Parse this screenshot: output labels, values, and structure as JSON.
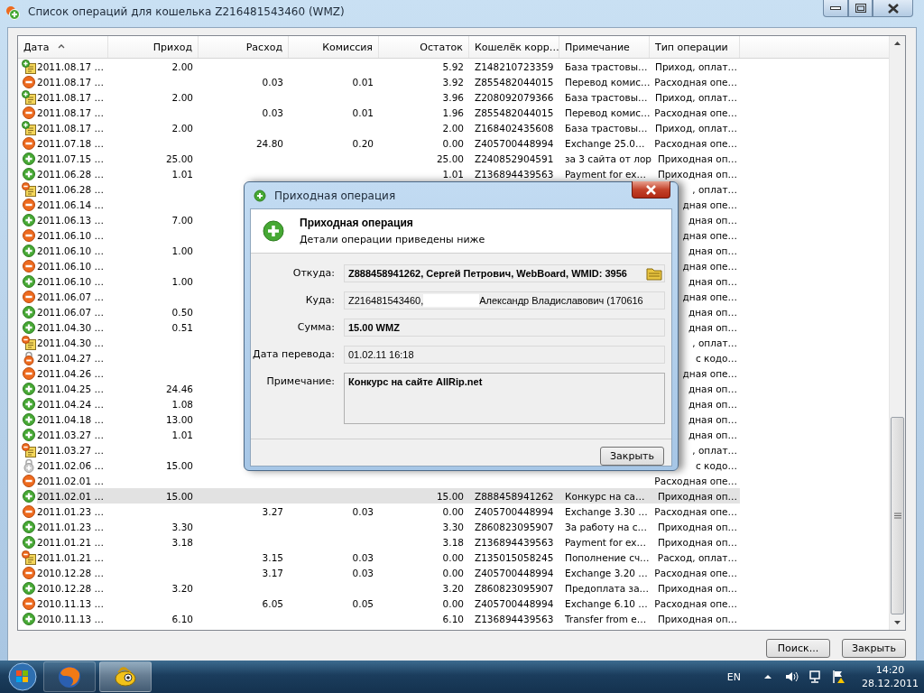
{
  "window": {
    "title": "Список операций для кошелька Z216481543460 (WMZ)"
  },
  "table": {
    "columns": [
      {
        "label": "Дата",
        "sorted": true
      },
      {
        "label": "Приход",
        "sorted": false
      },
      {
        "label": "Расход",
        "sorted": false
      },
      {
        "label": "Комиссия",
        "sorted": false
      },
      {
        "label": "Остаток",
        "sorted": false
      },
      {
        "label": "Кошелёк корр…",
        "sorted": false
      },
      {
        "label": "Примечание",
        "sorted": false
      },
      {
        "label": "Тип операции",
        "sorted": false
      }
    ],
    "rows": [
      {
        "kind": "doc_in",
        "date": "2011.08.17 …",
        "in": "2.00",
        "balance": "5.92",
        "wallet": "Z148210723359",
        "note": "База трастовы…",
        "type": "Приход, оплат…",
        "selected": false
      },
      {
        "kind": "out",
        "date": "2011.08.17 …",
        "out": "0.03",
        "fee": "0.01",
        "balance": "3.92",
        "wallet": "Z855482044015",
        "note": "Перевод комис…",
        "type": "Расходная опе…",
        "selected": false
      },
      {
        "kind": "doc_in",
        "date": "2011.08.17 …",
        "in": "2.00",
        "balance": "3.96",
        "wallet": "Z208092079366",
        "note": "База трастовы…",
        "type": "Приход, оплат…",
        "selected": false
      },
      {
        "kind": "out",
        "date": "2011.08.17 …",
        "out": "0.03",
        "fee": "0.01",
        "balance": "1.96",
        "wallet": "Z855482044015",
        "note": "Перевод комис…",
        "type": "Расходная опе…",
        "selected": false
      },
      {
        "kind": "doc_in",
        "date": "2011.08.17 …",
        "in": "2.00",
        "balance": "2.00",
        "wallet": "Z168402435608",
        "note": "База трастовы…",
        "type": "Приход, оплат…",
        "selected": false
      },
      {
        "kind": "out",
        "date": "2011.07.18 …",
        "out": "24.80",
        "fee": "0.20",
        "balance": "0.00",
        "wallet": "Z405700448994",
        "note": "Exchange 25.0…",
        "type": "Расходная опе…",
        "selected": false
      },
      {
        "kind": "in",
        "date": "2011.07.15 …",
        "in": "25.00",
        "balance": "25.00",
        "wallet": "Z240852904591",
        "note": "за 3 сайта от лор",
        "type": "Приходная оп…",
        "selected": false
      },
      {
        "kind": "in",
        "date": "2011.06.28 …",
        "in": "1.01",
        "balance": "1.01",
        "wallet": "Z136894439563",
        "note": "Payment for ex…",
        "type": "Приходная оп…",
        "selected": false
      },
      {
        "kind": "doc_out",
        "date": "2011.06.28 …",
        "type": ", оплат…",
        "selected": false
      },
      {
        "kind": "out",
        "date": "2011.06.14 …",
        "type": "дная опе…",
        "selected": false
      },
      {
        "kind": "in",
        "date": "2011.06.13 …",
        "in": "7.00",
        "type": "дная оп…",
        "selected": false
      },
      {
        "kind": "out",
        "date": "2011.06.10 …",
        "type": "дная опе…",
        "selected": false
      },
      {
        "kind": "in",
        "date": "2011.06.10 …",
        "in": "1.00",
        "type": "дная оп…",
        "selected": false
      },
      {
        "kind": "out",
        "date": "2011.06.10 …",
        "type": "дная опе…",
        "selected": false
      },
      {
        "kind": "in",
        "date": "2011.06.10 …",
        "in": "1.00",
        "type": "дная оп…",
        "selected": false
      },
      {
        "kind": "out",
        "date": "2011.06.07 …",
        "type": "дная опе…",
        "selected": false
      },
      {
        "kind": "in",
        "date": "2011.06.07 …",
        "in": "0.50",
        "type": "дная оп…",
        "selected": false
      },
      {
        "kind": "in",
        "date": "2011.04.30 …",
        "in": "0.51",
        "type": "дная оп…",
        "selected": false
      },
      {
        "kind": "doc_out",
        "date": "2011.04.30 …",
        "type": ", оплат…",
        "selected": false
      },
      {
        "kind": "lock_out",
        "date": "2011.04.27 …",
        "type": "с кодо…",
        "selected": false
      },
      {
        "kind": "out",
        "date": "2011.04.26 …",
        "type": "дная опе…",
        "selected": false
      },
      {
        "kind": "in",
        "date": "2011.04.25 …",
        "in": "24.46",
        "type": "дная оп…",
        "selected": false
      },
      {
        "kind": "in",
        "date": "2011.04.24 …",
        "in": "1.08",
        "type": "дная оп…",
        "selected": false
      },
      {
        "kind": "in",
        "date": "2011.04.18 …",
        "in": "13.00",
        "type": "дная оп…",
        "selected": false
      },
      {
        "kind": "in",
        "date": "2011.03.27 …",
        "in": "1.01",
        "type": "дная оп…",
        "selected": false
      },
      {
        "kind": "doc_out",
        "date": "2011.03.27 …",
        "type": ", оплат…",
        "selected": false
      },
      {
        "kind": "lock_in",
        "date": "2011.02.06 …",
        "in": "15.00",
        "type": "с кодо…",
        "selected": false
      },
      {
        "kind": "out",
        "date": "2011.02.01 …",
        "type": "Расходная опе…",
        "selected": false
      },
      {
        "kind": "in",
        "date": "2011.02.01 …",
        "in": "15.00",
        "balance": "15.00",
        "wallet": "Z888458941262",
        "note": "Конкурс на са…",
        "type": "Приходная оп…",
        "selected": true
      },
      {
        "kind": "out",
        "date": "2011.01.23 …",
        "out": "3.27",
        "fee": "0.03",
        "balance": "0.00",
        "wallet": "Z405700448994",
        "note": "Exchange 3.30 …",
        "type": "Расходная опе…",
        "selected": false
      },
      {
        "kind": "in",
        "date": "2011.01.23 …",
        "in": "3.30",
        "balance": "3.30",
        "wallet": "Z860823095907",
        "note": "За работу на с…",
        "type": "Приходная оп…",
        "selected": false
      },
      {
        "kind": "in",
        "date": "2011.01.21 …",
        "in": "3.18",
        "balance": "3.18",
        "wallet": "Z136894439563",
        "note": "Payment for ex…",
        "type": "Приходная оп…",
        "selected": false
      },
      {
        "kind": "doc_out",
        "date": "2011.01.21 …",
        "out": "3.15",
        "fee": "0.03",
        "balance": "0.00",
        "wallet": "Z135015058245",
        "note": "Пополнение сч…",
        "type": "Расход, оплат…",
        "selected": false
      },
      {
        "kind": "out",
        "date": "2010.12.28 …",
        "out": "3.17",
        "fee": "0.03",
        "balance": "0.00",
        "wallet": "Z405700448994",
        "note": "Exchange 3.20 …",
        "type": "Расходная опе…",
        "selected": false
      },
      {
        "kind": "in",
        "date": "2010.12.28 …",
        "in": "3.20",
        "balance": "3.20",
        "wallet": "Z860823095907",
        "note": "Предоплата за…",
        "type": "Приходная оп…",
        "selected": false
      },
      {
        "kind": "out",
        "date": "2010.11.13 …",
        "out": "6.05",
        "fee": "0.05",
        "balance": "0.00",
        "wallet": "Z405700448994",
        "note": "Exchange 6.10 …",
        "type": "Расходная опе…",
        "selected": false
      },
      {
        "kind": "in",
        "date": "2010.11.13 …",
        "in": "6.10",
        "balance": "6.10",
        "wallet": "Z136894439563",
        "note": "Transfer from e…",
        "type": "Приходная оп…",
        "selected": false
      }
    ]
  },
  "buttons": [
    "Поиск...",
    "Закрыть"
  ],
  "dialog": {
    "title": "Приходная операция",
    "heading": "Приходная операция",
    "subtitle": "Детали операции приведены ниже",
    "fields": [
      {
        "kind": "wallet",
        "label": "Откуда:",
        "value": "Z888458941262, Сергей Петрович, WebBoard, WMID: 3956",
        "bold": true
      },
      {
        "kind": "masked",
        "label": "Куда:",
        "value": "Z216481543460,",
        "value_after": "Александр Владиславович (170616",
        "bold": false
      },
      {
        "kind": "line",
        "label": "Сумма:",
        "value": "15.00 WMZ",
        "bold": true
      },
      {
        "kind": "line",
        "label": "Дата перевода:",
        "value": "01.02.11 16:18",
        "bold": false
      },
      {
        "kind": "area",
        "label": "Примечание:",
        "value": "Конкурс на сайте AllRip.net",
        "bold": true
      }
    ],
    "button": "Закрыть"
  },
  "taskbar": {
    "apps": [
      {
        "kind": "browser",
        "selected": false
      },
      {
        "kind": "messenger",
        "selected": true
      }
    ],
    "language": "EN",
    "time": "14:20",
    "date": "28.12.2011"
  }
}
